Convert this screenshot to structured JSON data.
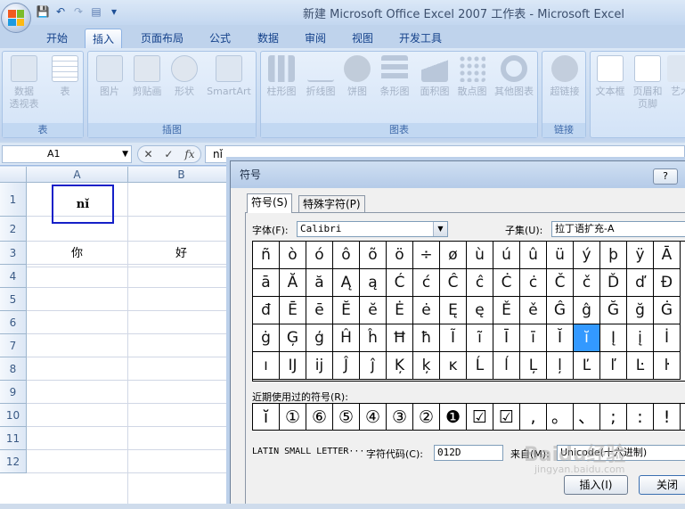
{
  "window": {
    "title": "新建 Microsoft Office Excel 2007 工作表 - Microsoft Excel"
  },
  "tabs": [
    "开始",
    "插入",
    "页面布局",
    "公式",
    "数据",
    "审阅",
    "视图",
    "开发工具"
  ],
  "active_tab": "插入",
  "ribbon": {
    "groups": [
      {
        "label": "表",
        "buttons": [
          "数据\n透视表",
          "表"
        ]
      },
      {
        "label": "插图",
        "buttons": [
          "图片",
          "剪贴画",
          "形状",
          "SmartArt"
        ]
      },
      {
        "label": "图表",
        "buttons": [
          "柱形图",
          "折线图",
          "饼图",
          "条形图",
          "面积图",
          "散点图",
          "其他图表"
        ]
      },
      {
        "label": "链接",
        "buttons": [
          "超链接"
        ]
      },
      {
        "label": "",
        "buttons": [
          "文本框",
          "页眉和\n页脚",
          "艺术"
        ]
      }
    ]
  },
  "formula_bar": {
    "name_box": "A1",
    "fx": "fx",
    "content": "nǐ"
  },
  "sheet": {
    "columns": [
      "A",
      "B"
    ],
    "rows": [
      "1",
      "2",
      "3",
      "4",
      "5",
      "6",
      "7",
      "8",
      "9",
      "10",
      "11",
      "12"
    ],
    "cells": {
      "A1": "nǐ",
      "A2": "你",
      "B2": "好"
    }
  },
  "dialog": {
    "title": "符号",
    "help": "?",
    "tabs": [
      "符号(S)",
      "特殊字符(P)"
    ],
    "font_label": "字体(F):",
    "font_value": "Calibri",
    "subset_label": "子集(U):",
    "subset_value": "拉丁语扩充-A",
    "grid": [
      [
        "ñ",
        "ò",
        "ó",
        "ô",
        "õ",
        "ö",
        "÷",
        "ø",
        "ù",
        "ú",
        "û",
        "ü",
        "ý",
        "þ",
        "ÿ",
        "Ā"
      ],
      [
        "ā",
        "Ă",
        "ă",
        "Ą",
        "ą",
        "Ć",
        "ć",
        "Ĉ",
        "ĉ",
        "Ċ",
        "ċ",
        "Č",
        "č",
        "Ď",
        "ď",
        "Đ"
      ],
      [
        "đ",
        "Ē",
        "ē",
        "Ĕ",
        "ĕ",
        "Ė",
        "ė",
        "Ę",
        "ę",
        "Ě",
        "ě",
        "Ĝ",
        "ĝ",
        "Ğ",
        "ğ",
        "Ġ"
      ],
      [
        "ġ",
        "Ģ",
        "ģ",
        "Ĥ",
        "ĥ",
        "Ħ",
        "ħ",
        "Ĩ",
        "ĩ",
        "Ī",
        "ī",
        "Ĭ",
        "ĭ",
        "Į",
        "į",
        "İ"
      ],
      [
        "ı",
        "Ĳ",
        "ĳ",
        "Ĵ",
        "ĵ",
        "Ķ",
        "ķ",
        "ĸ",
        "Ĺ",
        "ĺ",
        "Ļ",
        "ļ",
        "Ľ",
        "ľ",
        "Ŀ",
        "ŀ"
      ]
    ],
    "selected_char": "ĭ",
    "recent_label": "近期使用过的符号(R):",
    "recent": [
      "ĭ",
      "①",
      "⑥",
      "⑤",
      "④",
      "③",
      "②",
      "❶",
      "☑",
      "☑",
      ",",
      "。",
      "、",
      ";",
      ":",
      "!"
    ],
    "char_name": "LATIN SMALL LETTER···",
    "code_label": "字符代码(C):",
    "code_value": "012D",
    "from_label": "来自(M):",
    "from_value": "Unicode(十六进制)",
    "insert_btn": "插入(I)",
    "close_btn": "关闭"
  },
  "watermark": "Baidu经验",
  "watermark_url": "jingyan.baidu.com"
}
